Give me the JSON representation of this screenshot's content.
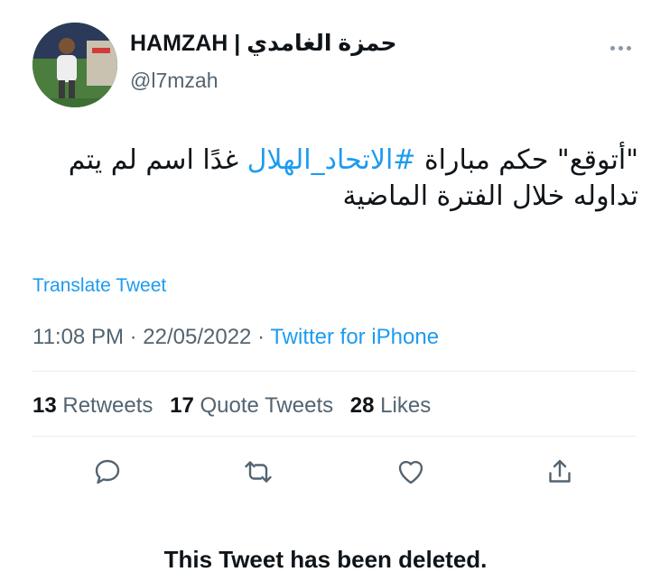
{
  "author": {
    "display_name": "HAMZAH | حمزة الغامدي",
    "handle": "@l7mzah"
  },
  "tweet": {
    "text_before": "\"أتوقع\" حكم مباراة ",
    "hashtag": "#الاتحاد_الهلال",
    "text_after": " غدًا اسم لم يتم تداوله خلال الفترة الماضية"
  },
  "translate_label": "Translate Tweet",
  "meta": {
    "time": "11:08 PM",
    "separator": " · ",
    "date": "22/05/2022",
    "source": "Twitter for iPhone"
  },
  "stats": {
    "retweets_count": "13",
    "retweets_label": "Retweets",
    "quotes_count": "17",
    "quotes_label": "Quote Tweets",
    "likes_count": "28",
    "likes_label": "Likes"
  },
  "actions": [
    "reply-icon",
    "retweet-icon",
    "like-icon",
    "share-icon"
  ],
  "colors": {
    "link": "#1d9bf0",
    "secondary": "#536471",
    "primary": "#0f1419"
  },
  "notice": "This Tweet has been deleted."
}
